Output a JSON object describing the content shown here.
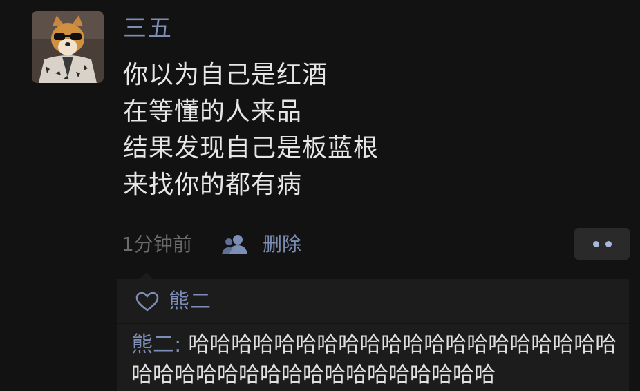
{
  "post": {
    "author": "三五",
    "lines": [
      "你以为自己是红酒",
      "在等懂的人来品",
      "结果发现自己是板蓝根",
      "来找你的都有病"
    ],
    "time": "1分钟前",
    "delete_label": "删除"
  },
  "likes": {
    "names": "熊二"
  },
  "comments": [
    {
      "author": "熊二",
      "separator": ": ",
      "text": "哈哈哈哈哈哈哈哈哈哈哈哈哈哈哈哈哈哈哈哈哈哈哈哈哈哈哈哈哈哈哈哈哈哈哈哈哈"
    }
  ],
  "icons": {
    "avatar": "dog-with-sunglasses-avatar",
    "user": "user-icon",
    "more": "more-dots-icon",
    "like": "heart-icon"
  },
  "colors": {
    "background": "#121212",
    "name_blue": "#7c8eb6",
    "text": "#e6e6e6",
    "muted": "#6b6b6b",
    "panel": "#1c1c1c"
  }
}
